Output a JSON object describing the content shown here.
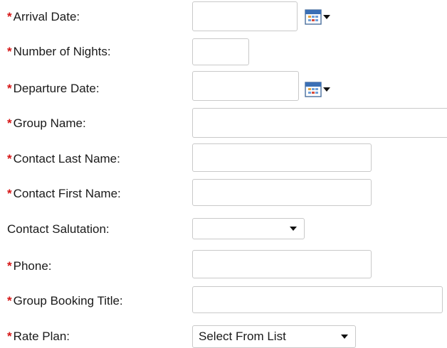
{
  "form": {
    "required_marker": "*",
    "arrival_date": {
      "label": "Arrival Date:",
      "value": "",
      "calendar_icon": "calendar-icon"
    },
    "number_of_nights": {
      "label": "Number of Nights:",
      "value": ""
    },
    "departure_date": {
      "label": "Departure Date:",
      "value": "",
      "calendar_icon": "calendar-icon"
    },
    "group_name": {
      "label": "Group Name:",
      "value": ""
    },
    "contact_last_name": {
      "label": "Contact Last Name:",
      "value": ""
    },
    "contact_first_name": {
      "label": "Contact First Name:",
      "value": ""
    },
    "contact_salutation": {
      "label": "Contact Salutation:",
      "selected": ""
    },
    "phone": {
      "label": "Phone:",
      "value": ""
    },
    "group_booking_title": {
      "label": "Group Booking Title:",
      "value": ""
    },
    "rate_plan": {
      "label": "Rate Plan:",
      "selected": "Select From List"
    }
  },
  "colors": {
    "required": "#d61515",
    "border": "#c9c9c9",
    "calendar_blue": "#3a6fb5"
  }
}
